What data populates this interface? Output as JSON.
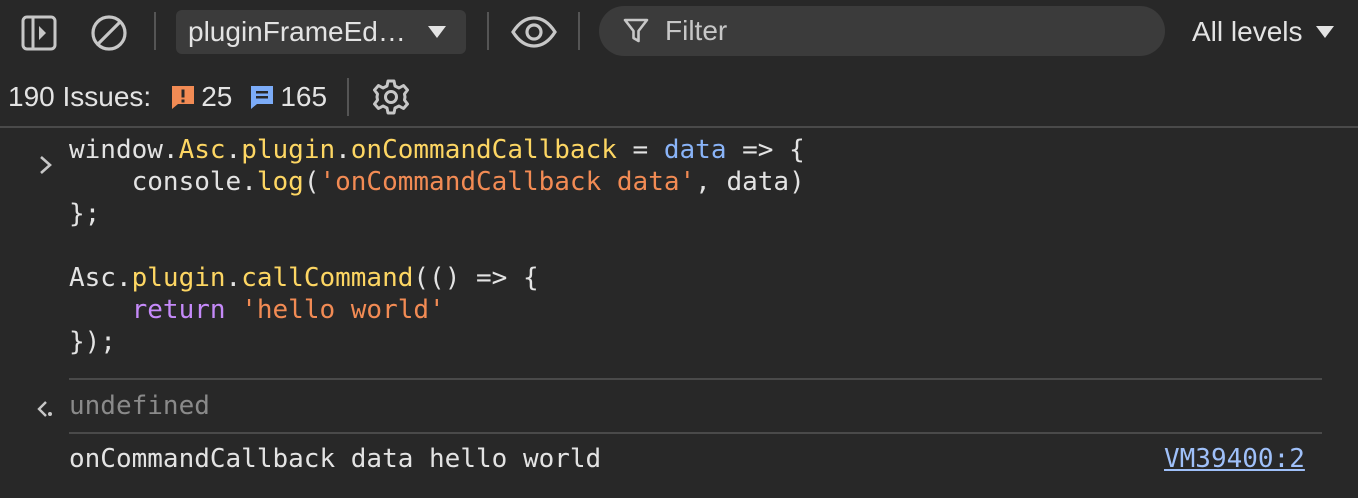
{
  "toolbar": {
    "context_label": "pluginFrameEd…",
    "filter_placeholder": "Filter",
    "levels_label": "All levels"
  },
  "issues": {
    "label": "190 Issues:",
    "warning_count": "25",
    "info_count": "165"
  },
  "console": {
    "input_lines": [
      [
        {
          "text": "window",
          "kind": "default"
        },
        {
          "text": ".",
          "kind": "default"
        },
        {
          "text": "Asc",
          "kind": "obj"
        },
        {
          "text": ".",
          "kind": "default"
        },
        {
          "text": "plugin",
          "kind": "obj"
        },
        {
          "text": ".",
          "kind": "default"
        },
        {
          "text": "onCommandCallback",
          "kind": "obj"
        },
        {
          "text": " = ",
          "kind": "default"
        },
        {
          "text": "data",
          "kind": "param"
        },
        {
          "text": " => {",
          "kind": "default"
        }
      ],
      [
        {
          "text": "    console",
          "kind": "default"
        },
        {
          "text": ".",
          "kind": "default"
        },
        {
          "text": "log",
          "kind": "obj"
        },
        {
          "text": "(",
          "kind": "default"
        },
        {
          "text": "'onCommandCallback data'",
          "kind": "str"
        },
        {
          "text": ", data)",
          "kind": "default"
        }
      ],
      [
        {
          "text": "};",
          "kind": "default"
        }
      ],
      [
        {
          "text": "",
          "kind": "default"
        }
      ],
      [
        {
          "text": "Asc",
          "kind": "default"
        },
        {
          "text": ".",
          "kind": "default"
        },
        {
          "text": "plugin",
          "kind": "obj"
        },
        {
          "text": ".",
          "kind": "default"
        },
        {
          "text": "callCommand",
          "kind": "obj"
        },
        {
          "text": "(() => {",
          "kind": "default"
        }
      ],
      [
        {
          "text": "    ",
          "kind": "default"
        },
        {
          "text": "return",
          "kind": "kw"
        },
        {
          "text": " ",
          "kind": "default"
        },
        {
          "text": "'hello world'",
          "kind": "str"
        }
      ],
      [
        {
          "text": "});",
          "kind": "default"
        }
      ]
    ],
    "result_text": "undefined",
    "log_text": "onCommandCallback data hello world",
    "log_source": "VM39400:2"
  },
  "colors": {
    "background": "#282828",
    "warning": "#f28b54",
    "info": "#7cacf8",
    "link": "#9fc0f9"
  }
}
